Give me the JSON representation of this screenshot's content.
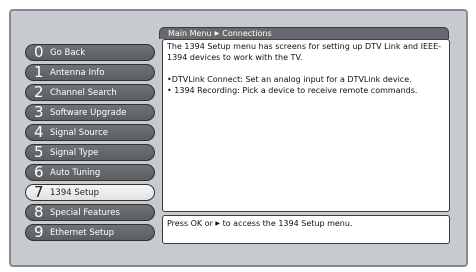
{
  "breadcrumb": {
    "parent": "Main Menu",
    "separator_icon": "right-triangle-icon",
    "current": "Connections"
  },
  "menu": {
    "items": [
      {
        "num": "0",
        "label": "Go Back"
      },
      {
        "num": "1",
        "label": "Antenna Info"
      },
      {
        "num": "2",
        "label": "Channel Search"
      },
      {
        "num": "3",
        "label": "Software Upgrade"
      },
      {
        "num": "4",
        "label": "Signal Source"
      },
      {
        "num": "5",
        "label": "Signal Type"
      },
      {
        "num": "6",
        "label": "Auto Tuning"
      },
      {
        "num": "7",
        "label": "1394 Setup"
      },
      {
        "num": "8",
        "label": "Special Features"
      },
      {
        "num": "9",
        "label": "Ethernet Setup"
      }
    ],
    "selected_index": 7
  },
  "info": {
    "intro": "The 1394 Setup menu has screens for setting up DTV Link and IEEE-1394 devices to work with the TV.",
    "bullet_1": "•DTVLink Connect: Set an analog input for a DTVLink device.",
    "bullet_2": "• 1394 Recording: Pick a device to receive remote commands."
  },
  "hint": {
    "before": "Press OK or ",
    "arrow_icon": "right-triangle-icon",
    "after": " to access the 1394 Setup menu."
  },
  "colors": {
    "panel": "#c7cbd0",
    "button": "#5b5e61",
    "button_selected": "#eeeeee",
    "breadcrumb": "#666a6e"
  }
}
